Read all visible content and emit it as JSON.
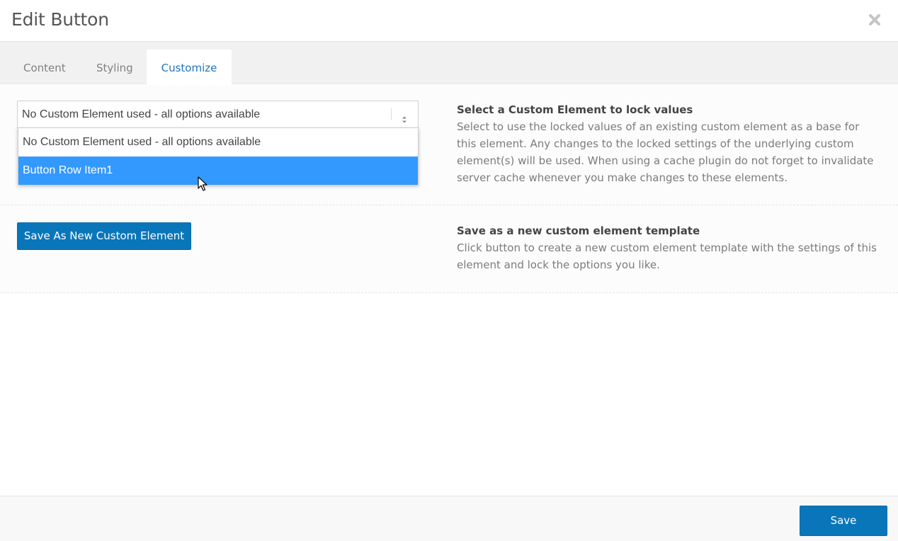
{
  "modal": {
    "title": "Edit Button"
  },
  "tabs": [
    {
      "label": "Content",
      "active": false
    },
    {
      "label": "Styling",
      "active": false
    },
    {
      "label": "Customize",
      "active": true
    }
  ],
  "custom_element": {
    "select_value": "No Custom Element used - all options available",
    "options": [
      {
        "label": "No Custom Element used - all options available",
        "highlighted": false
      },
      {
        "label": "Button Row Item1",
        "highlighted": true
      }
    ],
    "title": "Select a Custom Element to lock values",
    "description": "Select to use the locked values of an existing custom element as a base for this element. Any changes to the locked settings of the underlying custom element(s) will be used. When using a cache plugin do not forget to invalidate server cache whenever you make changes to these elements."
  },
  "save_template": {
    "button_label": "Save As New Custom Element",
    "title": "Save as a new custom element template",
    "description": "Click button to create a new custom element template with the settings of this element and lock the options you like."
  },
  "footer": {
    "save_label": "Save"
  },
  "colors": {
    "accent": "#0a76ba",
    "highlight": "#3399ff",
    "active_tab_text": "#1e73be"
  },
  "icons": {
    "close": "close-icon",
    "select_arrow": "updown-arrows-icon",
    "cursor": "mouse-pointer-icon"
  }
}
